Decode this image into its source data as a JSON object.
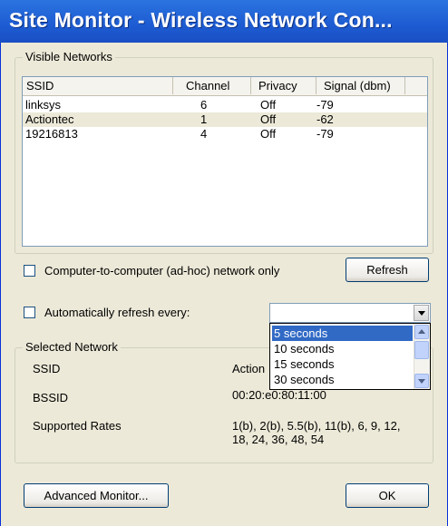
{
  "window": {
    "title": "Site Monitor - Wireless Network Con..."
  },
  "visible_networks": {
    "label": "Visible Networks",
    "columns": [
      "SSID",
      "Channel",
      "Privacy",
      "Signal (dbm)"
    ],
    "rows": [
      {
        "ssid": "linksys",
        "channel": "6",
        "privacy": "Off",
        "signal": "-79"
      },
      {
        "ssid": "Actiontec",
        "channel": "1",
        "privacy": "Off",
        "signal": "-62"
      },
      {
        "ssid": "19216813",
        "channel": "4",
        "privacy": "Off",
        "signal": "-79"
      }
    ]
  },
  "adhoc": {
    "label": "Computer-to-computer (ad-hoc) network only",
    "checked": false
  },
  "refresh_button": "Refresh",
  "auto_refresh": {
    "label": "Automatically refresh every:",
    "checked": false,
    "selected": "",
    "options": [
      "5 seconds",
      "10 seconds",
      "15 seconds",
      "30 seconds"
    ],
    "highlighted": "5 seconds"
  },
  "selected_network": {
    "label": "Selected Network",
    "ssid_label": "SSID",
    "ssid_value": "Action",
    "bssid_label": "BSSID",
    "bssid_value": "00:20:e0:80:11:00",
    "rates_label": "Supported Rates",
    "rates_value_line1": "1(b), 2(b), 5.5(b), 11(b), 6, 9, 12,",
    "rates_value_line2": "18, 24, 36, 48, 54"
  },
  "buttons": {
    "advanced": "Advanced Monitor...",
    "ok": "OK"
  }
}
